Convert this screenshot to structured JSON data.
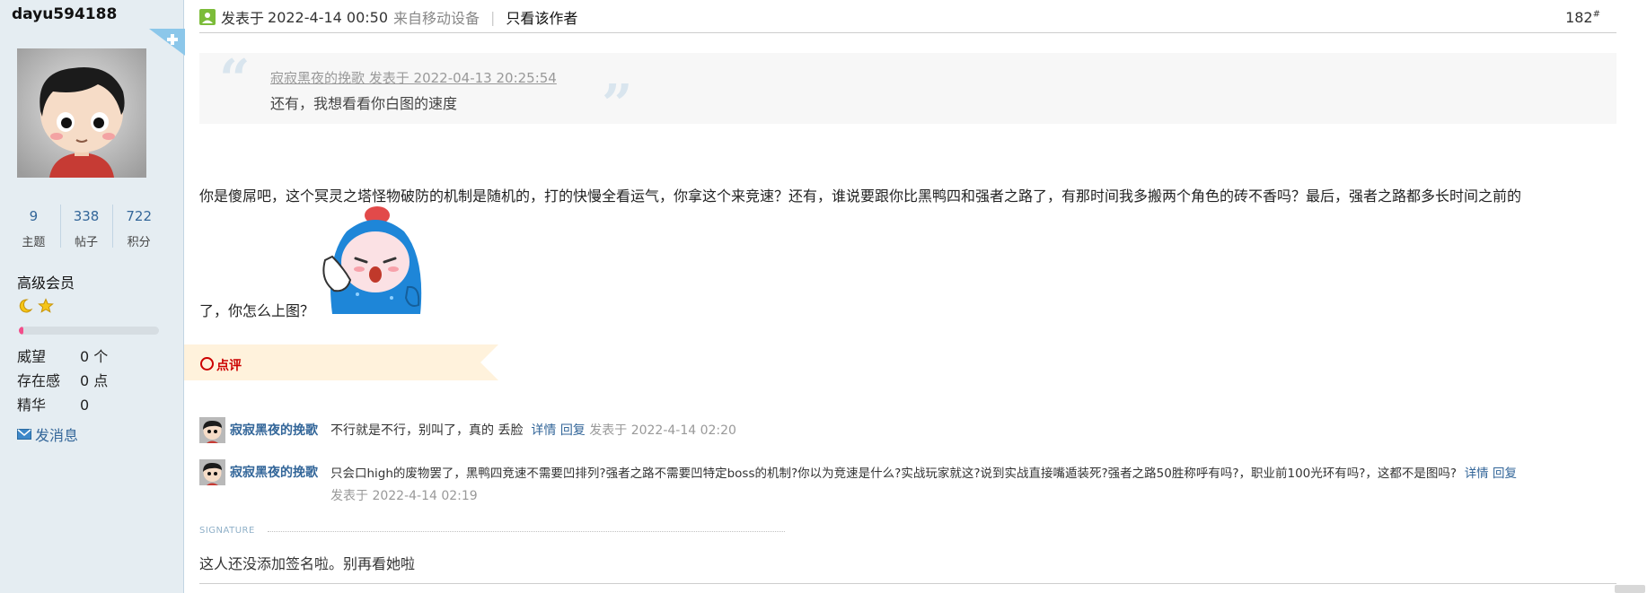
{
  "sidebar": {
    "username": "dayu594188",
    "stats": [
      {
        "value": "9",
        "label": "主题"
      },
      {
        "value": "338",
        "label": "帖子"
      },
      {
        "value": "722",
        "label": "积分"
      }
    ],
    "rank": "高级会员",
    "rank_progress_percent": 3,
    "profile": [
      {
        "key": "威望",
        "value": "0 个"
      },
      {
        "key": "存在感",
        "value": "0 点"
      },
      {
        "key": "精华",
        "value": "0"
      }
    ],
    "send_message": "发消息",
    "colors": {
      "panel_bg": "#e5edf2",
      "link": "#336699",
      "progress": "#f24d8a"
    }
  },
  "post": {
    "date_label": "发表于",
    "date": "2022-4-14 00:50",
    "device": "来自移动设备",
    "separator": "|",
    "only_author": "只看该作者",
    "floor": "182",
    "floor_suffix": "#",
    "quote": {
      "source": "寂寂黑夜的挽歌 发表于 2022-04-13 20:25:54",
      "text": "还有，我想看看你白图的速度",
      "open_mark": "“",
      "close_mark": "”"
    },
    "body_line1": "你是傻屌吧，这个冥灵之塔怪物破防的机制是随机的，打的快慢全看运气，你拿这个来竞速？还有，谁说要跟你比黑鸭四和强者之路了，有那时间我多搬两个角色的砖不香吗？最后，强者之路都多长时间之前的",
    "body_line2": "了，你怎么上图？",
    "sticker": "crying-blue-hooded-character-sticker"
  },
  "comments_section": {
    "tab_label": "点评",
    "comments": [
      {
        "user": "寂寂黑夜的挽歌",
        "text": "不行就是不行，别叫了，真的 丢脸",
        "detail": "详情",
        "reply": "回复",
        "time": "发表于 2022-4-14 02:20"
      },
      {
        "user": "寂寂黑夜的挽歌",
        "text": "只会口high的废物罢了，黑鸭四竞速不需要凹排列?强者之路不需要凹特定boss的机制?你以为竞速是什么?实战玩家就这?说到实战直接嘴遁装死?强者之路50胜称呼有吗?，职业前100光环有吗?，这都不是图吗?",
        "detail": "详情",
        "reply": "回复",
        "time": "发表于 2022-4-14 02:19"
      }
    ]
  },
  "signature": {
    "label": "SIGNATURE",
    "text": "这人还没添加签名啦。别再看她啦"
  }
}
